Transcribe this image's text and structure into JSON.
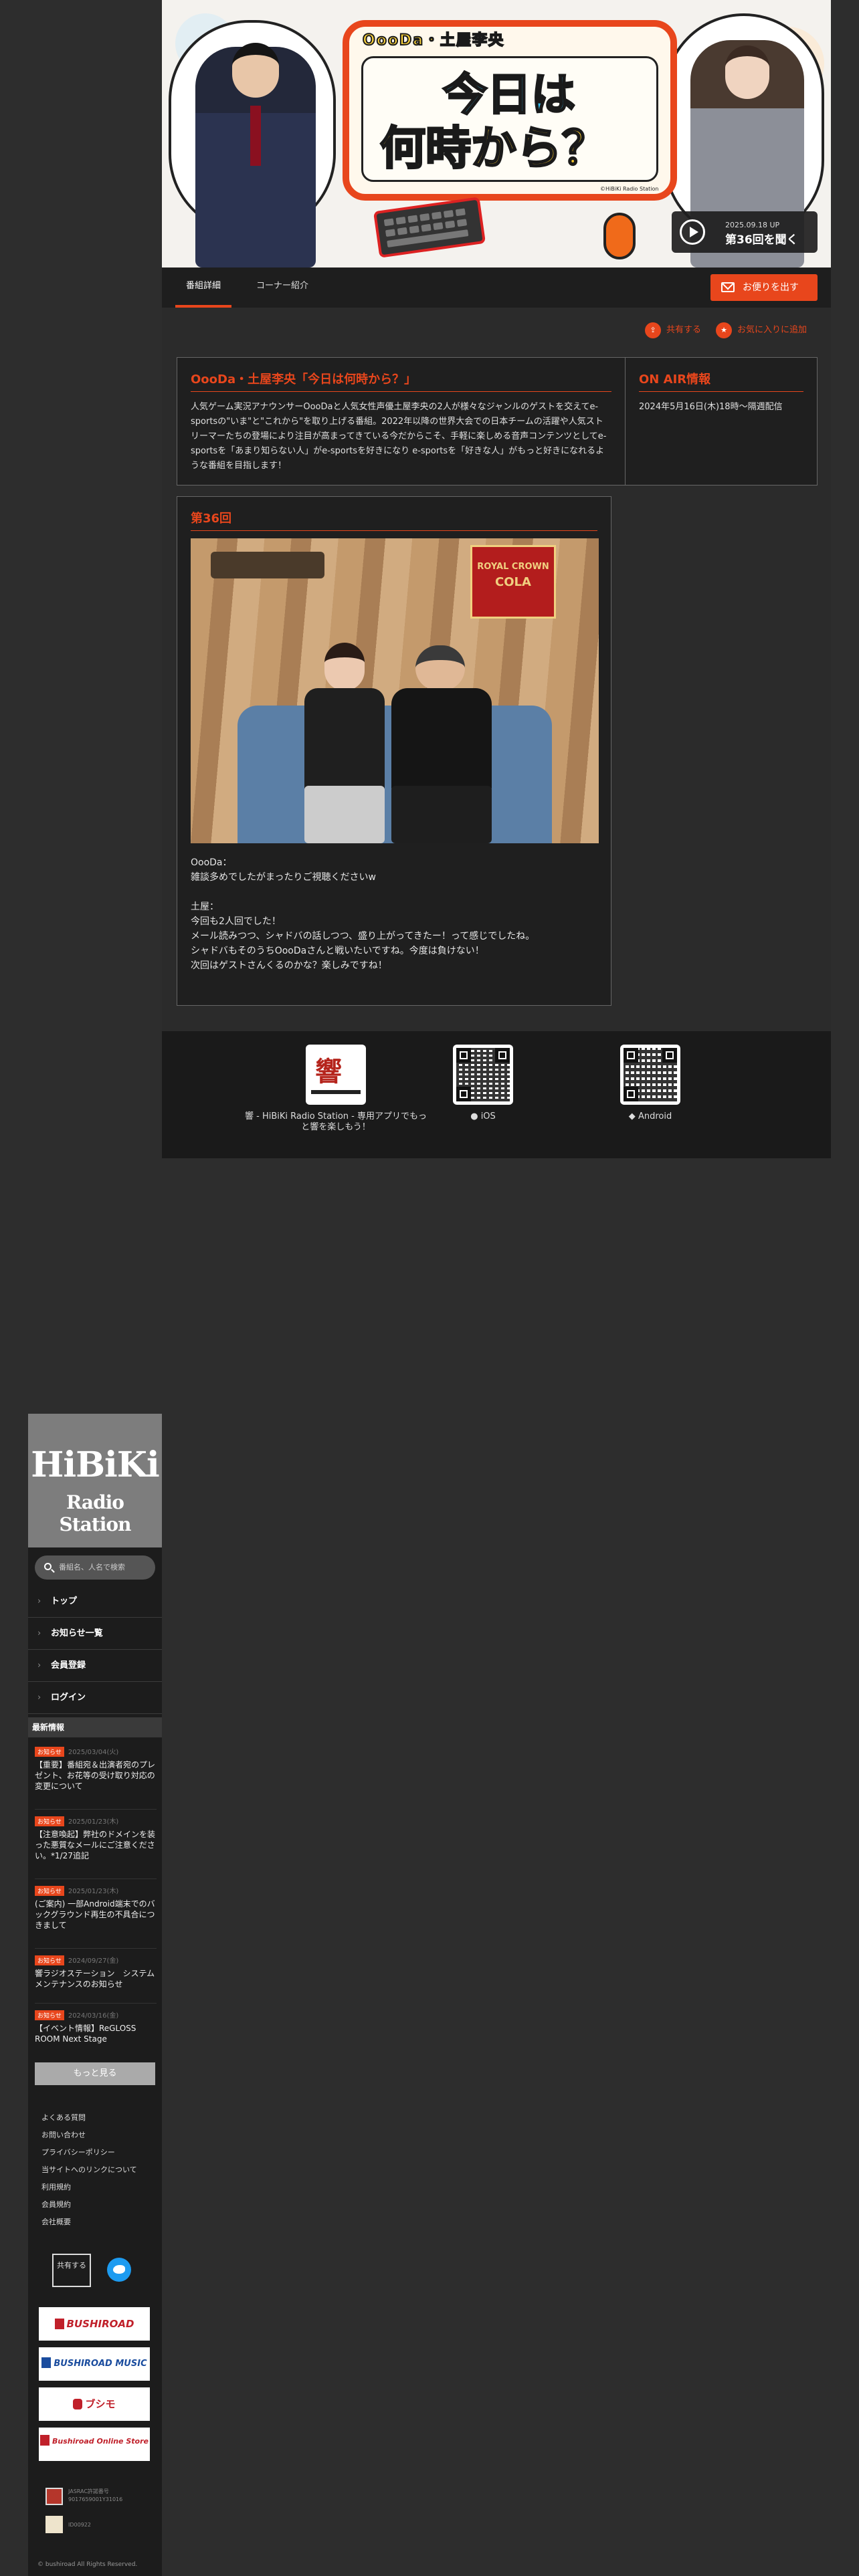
{
  "hero": {
    "logo_small": "OooDa・土屋李央",
    "logo_line1": "今日は",
    "logo_line2": "何時から？",
    "credit": "©HiBiKi Radio Station",
    "play_date": "2025.09.18 UP",
    "play_title": "第36回を聞く"
  },
  "tabs": [
    {
      "label": "番組詳細"
    },
    {
      "label": "コーナー紹介"
    }
  ],
  "mail_button": "お便りを出す",
  "share": {
    "share_label": "共有する",
    "fav_label": "お気に入りに追加"
  },
  "info": {
    "title": "OooDa・土屋李央「今日は何時から？」",
    "description": "人気ゲーム実況アナウンサーOooDaと人気女性声優土屋李央の2人が様々なジャンルのゲストを交えてe-sportsの\"いま\"と\"これから\"を取り上げる番組。2022年以降の世界大会での日本チームの活躍や人気ストリーマーたちの登場により注目が高まってきている今だからこそ、手軽に楽しめる音声コンテンツとしてe-sportsを「あまり知らない人」がe-sportsを好きになり e-sportsを「好きな人」がもっと好きになれるような番組を目指します！",
    "onair_title": "ON AIR情報",
    "onair_text": "2024年5月16日(木)18時〜隔週配信"
  },
  "episode": {
    "title": "第36回",
    "text": "OooDa：\n雑談多めでしたがまったりご視聴くださいw\n\n土屋：\n今回も2人回でした！\nメール読みつつ、シャドバの話しつつ、盛り上がってきたー！って感じでしたね。\nシャドバもそのうちOooDaさんと戦いたいですね。今度は負けない！\n次回はゲストさんくるのかな？楽しみですね！",
    "sign_line1": "ROYAL CROWN",
    "sign_line2": "COLA"
  },
  "apps": {
    "app_caption": "響 - HiBiKi Radio Station - 専用アプリでもっと響を楽しもう！",
    "ios_label": "iOS",
    "android_label": "Android"
  },
  "sidebar": {
    "brand_line1": "HiBiKi",
    "brand_line2": "Radio Station",
    "search_placeholder": "番組名、人名で検索",
    "nav": [
      {
        "label": "トップ"
      },
      {
        "label": "お知らせ一覧"
      },
      {
        "label": "会員登録"
      },
      {
        "label": "ログイン"
      }
    ],
    "news_heading": "最新情報",
    "news": [
      {
        "tag": "お知らせ",
        "date": "2025/03/04(火)",
        "title": "【重要】番組宛＆出演者宛のプレゼント、お花等の受け取り対応の変更について"
      },
      {
        "tag": "お知らせ",
        "date": "2025/01/23(木)",
        "title": "【注意喚起】弊社のドメインを装った悪質なメールにご注意ください。*1/27追記"
      },
      {
        "tag": "お知らせ",
        "date": "2025/01/23(木)",
        "title": "(ご案内) 一部Android端末でのバックグラウンド再生の不具合につきまして"
      },
      {
        "tag": "お知らせ",
        "date": "2024/09/27(金)",
        "title": "響ラジオステーション　システムメンテナンスのお知らせ"
      },
      {
        "tag": "お知らせ",
        "date": "2024/03/16(金)",
        "title": "【イベント情報】ReGLOSS ROOM Next Stage"
      }
    ],
    "more_label": "もっと見る",
    "links": [
      "よくある質問",
      "お問い合わせ",
      "プライバシーポリシー",
      "当サイトへのリンクについて",
      "利用規約",
      "会員規約",
      "会社概要"
    ],
    "share_label": "共有する",
    "partners": [
      "BUSHIROAD",
      "BUSHIROAD MUSIC",
      "ブシモ",
      "Bushiroad Online Store"
    ],
    "jasrac_text": "JASRAC許諾番号 9017659001Y31016",
    "nextone_text": "ID00922",
    "copyright": "© bushiroad All Rights Reserved."
  }
}
